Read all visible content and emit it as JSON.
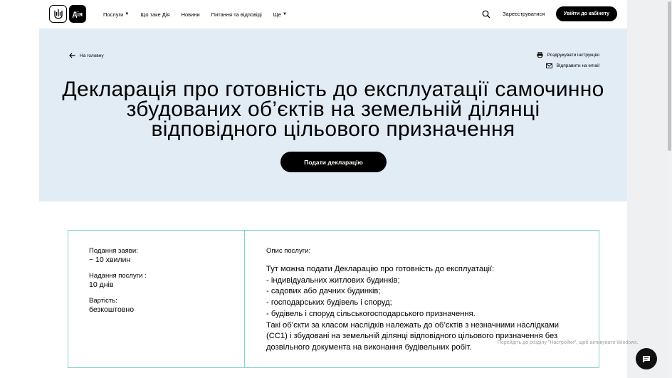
{
  "header": {
    "logo_text": "Дія",
    "nav": [
      {
        "label": "Послуги",
        "has_caret": true
      },
      {
        "label": "Що таке Дія",
        "has_caret": false
      },
      {
        "label": "Новини",
        "has_caret": false
      },
      {
        "label": "Питання та відповіді",
        "has_caret": false
      },
      {
        "label": "Ще",
        "has_caret": true
      }
    ],
    "search_icon": "search-icon",
    "register_label": "Зареєструватися",
    "login_label": "Увійти до кабінету"
  },
  "hero": {
    "back_label": "На головну",
    "print_label": "Роздрукувати інструкцію",
    "email_label": "Відправити на email",
    "title": "Декларація про готовність до експлуатації самочинно збудованих об’єктів на земельній ділянці відповідного цільового призначення",
    "submit_label": "Подати декларацію"
  },
  "info": {
    "submission_time_label": "Подання заяви:",
    "submission_time_value": "~ 10 хвилин",
    "service_time_label": "Надання послуги :",
    "service_time_value": "10 днів",
    "cost_label": "Вартість:",
    "cost_value": "безкоштовно",
    "description_label": "Опис послуги:",
    "description_text": "Тут можна подати Декларацію про готовність до експлуатації:\n- індивідуальних житлових будинків;\n- садових або дачних будинків;\n- господарських будівель і споруд;\n- будівель і споруд сільськогосподарського призначення.\nТакі об’єкти за класом наслідків належать до об’єктів з незначними наслідками (СС1) і збудовані на земельній ділянці відповідного цільового призначення без дозвільного документа на виконання будівельних робіт."
  },
  "overlay": {
    "watermark_text": "Перейдіть до розділу \"Настройки\", щоб активувати Windows."
  },
  "colors": {
    "hero_bg": "#e2ecf4",
    "accent_border": "#7fd3cf",
    "button_bg": "#000000"
  }
}
